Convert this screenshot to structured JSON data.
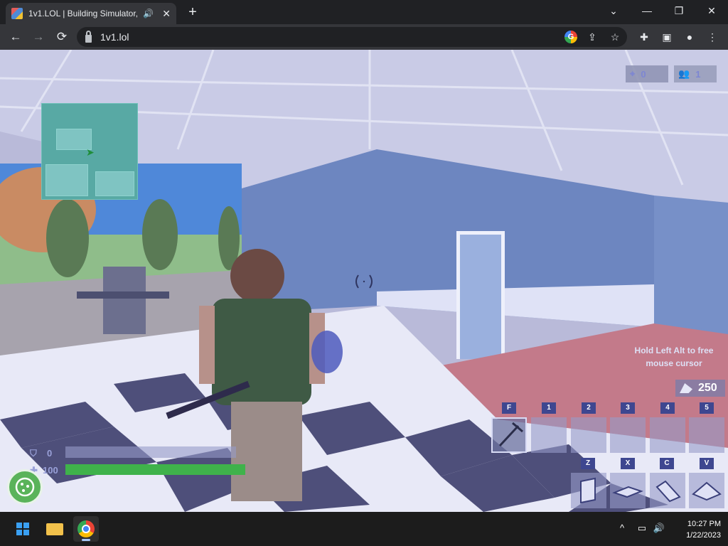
{
  "browser": {
    "tab": {
      "title": "1v1.LOL | Building Simulator,",
      "audio_icon": "speaker-icon",
      "close_label": "✕"
    },
    "new_tab_label": "+",
    "window_controls": {
      "dropdown": "⌄",
      "minimize": "—",
      "restore": "❐",
      "close": "✕"
    },
    "nav": {
      "back": "←",
      "forward": "→",
      "reload": "⟳"
    },
    "address": "1v1.lol",
    "omnibox_icons": [
      "google-lens-icon",
      "share-icon",
      "bookmark-star-icon"
    ],
    "toolbar_icons": [
      "extensions-icon",
      "sidebar-icon",
      "profile-icon",
      "menu-icon"
    ]
  },
  "game": {
    "hud": {
      "eliminations": "0",
      "players": "1",
      "hint_line1": "Hold Left Alt to free",
      "hint_line2": "mouse cursor",
      "materials": "250",
      "shield": "0",
      "health": "100",
      "shield_fraction": 0.0,
      "health_fraction": 1.0
    },
    "hotbar": {
      "weapon_keys": [
        "F",
        "1",
        "2",
        "3",
        "4",
        "5"
      ],
      "selected_key": "F",
      "build_keys": [
        "Z",
        "X",
        "C",
        "V"
      ],
      "build_pieces": [
        "wall",
        "floor",
        "stairs",
        "cone"
      ]
    },
    "colors": {
      "health": "#3fb24b",
      "key_badge": "#3e4790",
      "minimap": "#58a9a4"
    }
  },
  "taskbar": {
    "apps": [
      "start-icon",
      "file-explorer-icon",
      "chrome-icon"
    ],
    "tray_icons": [
      "chevron-up-icon",
      "network-icon",
      "volume-icon"
    ],
    "time": "10:27 PM",
    "date": "1/22/2023"
  }
}
